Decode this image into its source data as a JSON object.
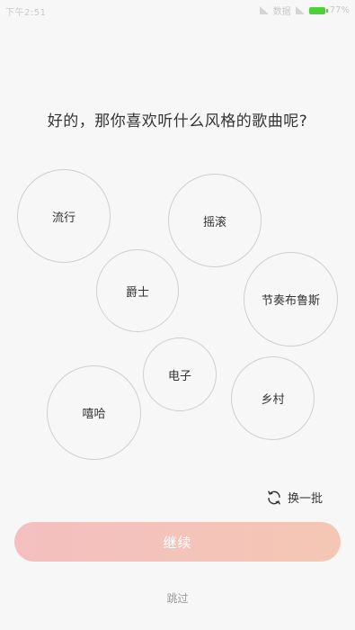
{
  "status_bar": {
    "time": "下午2:51",
    "network_label": "数据",
    "battery": "77%"
  },
  "question": "好的，那你喜欢听什么风格的歌曲呢?",
  "genres": {
    "pop": "流行",
    "rock": "摇滚",
    "jazz": "爵士",
    "rnb": "节奏布鲁斯",
    "electronic": "电子",
    "hiphop": "嘻哈",
    "country": "乡村"
  },
  "refresh": {
    "label": "换一批",
    "icon": "refresh-icon"
  },
  "continue_label": "继续",
  "skip_label": "跳过",
  "colors": {
    "background": "#f7f7f7",
    "button_gradient_start": "#f4bfc0",
    "button_gradient_end": "#f4c7b4",
    "bubble_border": "#cfcfcf"
  }
}
